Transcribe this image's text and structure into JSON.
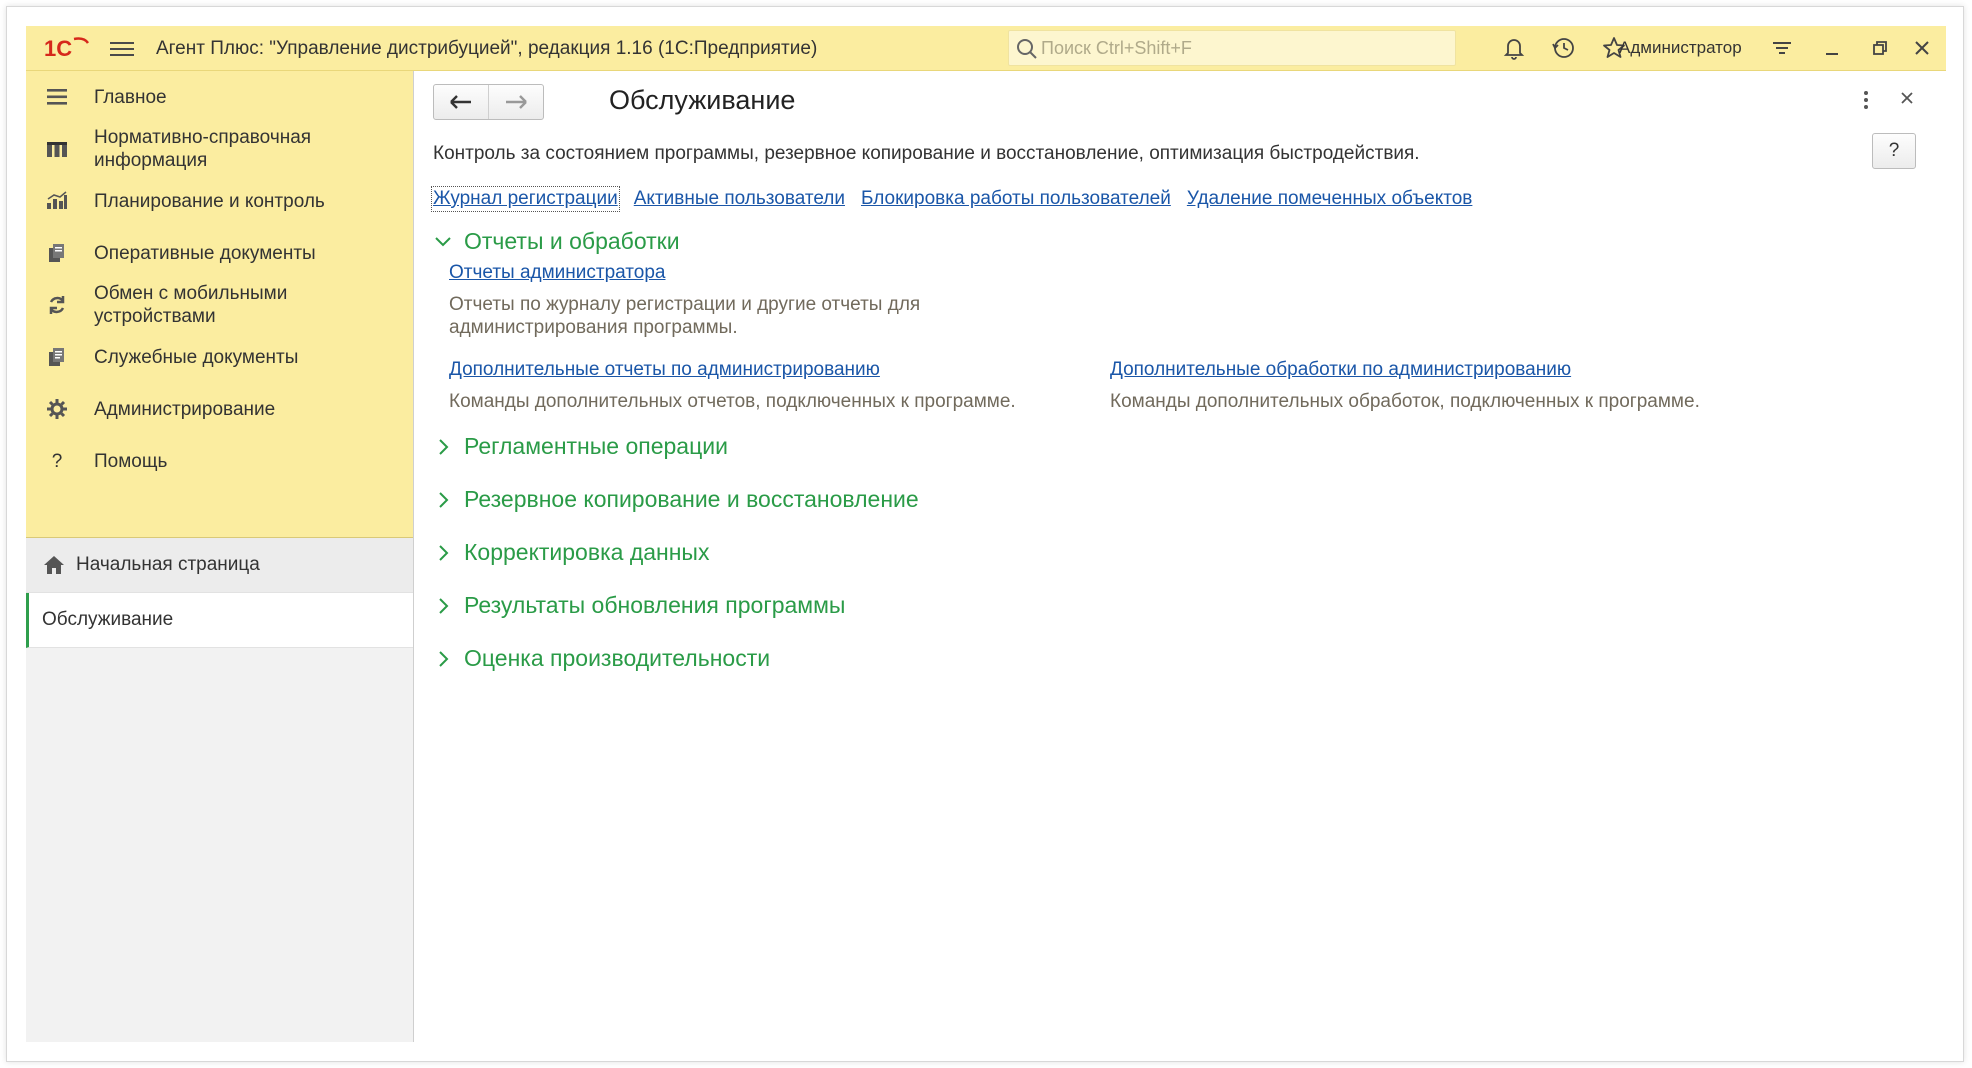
{
  "titlebar": {
    "logo": "1С",
    "app_title": "Агент Плюс: \"Управление дистрибуцией\", редакция 1.16  (1С:Предприятие)",
    "search_placeholder": "Поиск Ctrl+Shift+F",
    "user": "Администратор",
    "icons": [
      "menu-icon",
      "bell-icon",
      "history-icon",
      "star-icon",
      "settings-lines-icon",
      "minimize-icon",
      "restore-icon",
      "close-icon"
    ]
  },
  "sidebar": {
    "sections": [
      {
        "label": "Главное",
        "icon": "menu-lines-icon"
      },
      {
        "label": "Нормативно-справочная\nинформация",
        "icon": "catalog-icon"
      },
      {
        "label": "Планирование и контроль",
        "icon": "bar-chart-icon"
      },
      {
        "label": "Оперативные документы",
        "icon": "documents-icon"
      },
      {
        "label": "Обмен с мобильными\nустройствами",
        "icon": "sync-icon"
      },
      {
        "label": "Служебные документы",
        "icon": "service-docs-icon"
      },
      {
        "label": "Администрирование",
        "icon": "gear-icon"
      },
      {
        "label": "Помощь",
        "icon": "question-icon"
      }
    ],
    "open_windows": [
      {
        "label": "Начальная страница",
        "icon": "home-icon"
      },
      {
        "label": "Обслуживание"
      }
    ]
  },
  "form": {
    "title": "Обслуживание",
    "description": "Контроль за состоянием программы, резервное копирование и восстановление, оптимизация быстродействия.",
    "help": "?",
    "top_links": [
      "Журнал регистрации",
      "Активные пользователи",
      "Блокировка работы пользователей",
      "Удаление помеченных объектов"
    ],
    "groups": [
      {
        "title": "Отчеты и обработки",
        "expanded": true,
        "items": [
          {
            "link": "Отчеты администратора",
            "desc": "Отчеты по журналу регистрации и другие отчеты для\nадминистрирования программы."
          },
          {
            "link": "Дополнительные отчеты по администрированию",
            "desc": "Команды дополнительных отчетов, подключенных к программе."
          },
          {
            "link": "Дополнительные обработки по администрированию",
            "desc": "Команды дополнительных обработок, подключенных к программе."
          }
        ]
      },
      {
        "title": "Регламентные операции",
        "expanded": false
      },
      {
        "title": "Резервное копирование и восстановление",
        "expanded": false
      },
      {
        "title": "Корректировка данных",
        "expanded": false
      },
      {
        "title": "Результаты обновления программы",
        "expanded": false
      },
      {
        "title": "Оценка производительности",
        "expanded": false
      }
    ]
  },
  "colors": {
    "titlebar_bg": "#fbeda0",
    "link": "#1a56a8",
    "group_title": "#2a9b47",
    "active_marker": "#2e9e4c"
  }
}
